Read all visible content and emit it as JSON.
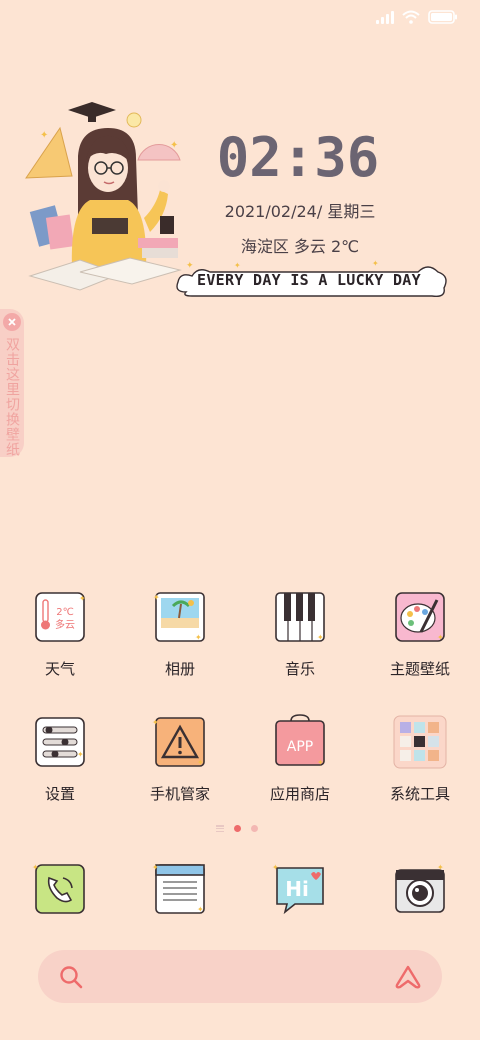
{
  "status": {
    "icons": [
      "signal-icon",
      "wifi-icon",
      "battery-icon"
    ]
  },
  "widget": {
    "time": "02:36",
    "date": "2021/02/24/ 星期三",
    "weather": "海淀区 多云 2℃",
    "slogan": "EVERY DAY IS A LUCKY DAY"
  },
  "wallpaper_tab": {
    "label": "双击这里切换壁纸"
  },
  "apps": [
    [
      {
        "label": "天气",
        "icon": "weather-icon",
        "icon_text_1": "2℃",
        "icon_text_2": "多云"
      },
      {
        "label": "相册",
        "icon": "gallery-icon"
      },
      {
        "label": "音乐",
        "icon": "music-icon"
      },
      {
        "label": "主题壁纸",
        "icon": "themes-icon"
      }
    ],
    [
      {
        "label": "设置",
        "icon": "settings-icon"
      },
      {
        "label": "手机管家",
        "icon": "security-icon"
      },
      {
        "label": "应用商店",
        "icon": "app-store-icon",
        "icon_text": "APP"
      },
      {
        "label": "系统工具",
        "icon": "tools-folder-icon"
      }
    ]
  ],
  "dock": [
    {
      "icon": "phone-icon"
    },
    {
      "icon": "browser-icon"
    },
    {
      "icon": "messages-icon",
      "icon_text": "Hi"
    },
    {
      "icon": "camera-icon"
    }
  ],
  "pages": {
    "count": 2,
    "active": 1
  },
  "colors": {
    "background": "#fde4d3",
    "accent_red": "#ee6b6b",
    "clock": "#6b6472"
  }
}
